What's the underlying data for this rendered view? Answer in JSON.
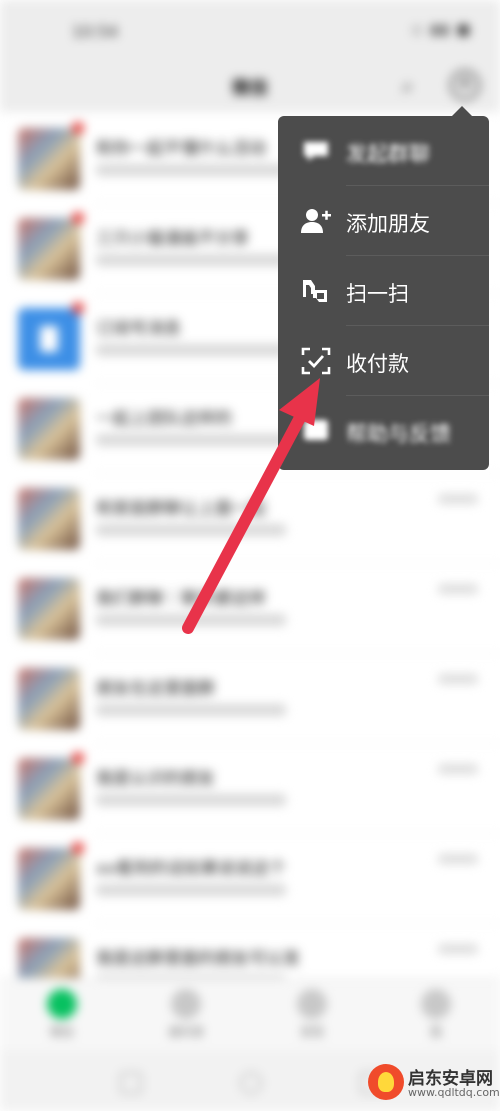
{
  "statusbar": {
    "time": "10:54",
    "icons": "◇ ▮▮ ■"
  },
  "navbar": {
    "title": "微信"
  },
  "chats": [
    {
      "title": "和你一起不懂什么活动",
      "avatar": "photo",
      "badge": true
    },
    {
      "title": "三只小猫漫画不分享",
      "avatar": "photo",
      "badge": true
    },
    {
      "title": "订阅号消息",
      "avatar": "blue",
      "badge": true
    },
    {
      "title": "一起上团队这样的",
      "avatar": "photo",
      "badge": false
    },
    {
      "title": "和家庭群聊让上面一起",
      "avatar": "photo",
      "badge": false
    },
    {
      "title": "我们群聊｜聊天都这样",
      "avatar": "photo",
      "badge": false
    },
    {
      "title": "朋友在这里面群",
      "avatar": "photo",
      "badge": false
    },
    {
      "title": "我是认识的朋友",
      "avatar": "photo",
      "badge": true
    },
    {
      "title": "xx看到的话如果说说这个",
      "avatar": "photo",
      "badge": true
    },
    {
      "title": "我是这群里面的朋友可以发",
      "avatar": "photo",
      "badge": false
    }
  ],
  "tabbar": {
    "tabs": [
      "微信",
      "通讯录",
      "发现",
      "我"
    ]
  },
  "menu": {
    "items": [
      {
        "label": "发起群聊",
        "icon": "chat-bubble-icon",
        "blurred": true
      },
      {
        "label": "添加朋友",
        "icon": "add-friend-icon",
        "blurred": false
      },
      {
        "label": "扫一扫",
        "icon": "scan-icon",
        "blurred": false
      },
      {
        "label": "收付款",
        "icon": "payment-icon",
        "blurred": false
      },
      {
        "label": "帮助与反馈",
        "icon": "help-icon",
        "blurred": true
      }
    ]
  },
  "colors": {
    "menu_bg": "#4c4c4c",
    "arrow": "#e8334a",
    "wechat_green": "#07c160"
  },
  "watermark": {
    "name": "启东安卓网",
    "url": "www.qdltdq.com"
  }
}
